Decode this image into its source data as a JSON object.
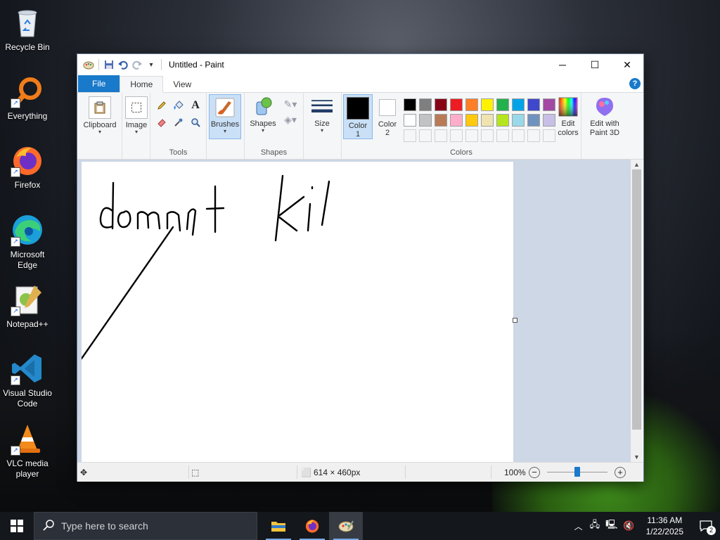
{
  "desktop": {
    "icons": [
      {
        "label": "Recycle Bin"
      },
      {
        "label": "Everything"
      },
      {
        "label": "Firefox"
      },
      {
        "label": "Microsoft Edge"
      },
      {
        "label": "Notepad++"
      },
      {
        "label": "Visual Studio Code"
      },
      {
        "label": "VLC media player"
      }
    ]
  },
  "window": {
    "title": "Untitled - Paint",
    "tabs": {
      "file": "File",
      "home": "Home",
      "view": "View"
    },
    "help": "?"
  },
  "ribbon": {
    "clipboard": "Clipboard",
    "image": "Image",
    "tools_group": "Tools",
    "brushes": "Brushes",
    "shapes": "Shapes",
    "shapes_group": "Shapes",
    "size": "Size",
    "color1": "Color",
    "color1_num": "1",
    "color2": "Color",
    "color2_num": "2",
    "colors_group": "Colors",
    "edit_colors": "Edit colors",
    "edit_paint3d": "Edit with Paint 3D",
    "text_tool": "A",
    "palette_row1": [
      "#000000",
      "#7f7f7f",
      "#880015",
      "#ed1c24",
      "#ff7f27",
      "#fff200",
      "#22b14c",
      "#00a2e8",
      "#3f48cc",
      "#a349a4"
    ],
    "palette_row2": [
      "#ffffff",
      "#c3c3c3",
      "#b97a57",
      "#ffaec9",
      "#ffc90e",
      "#efe4b0",
      "#b5e61d",
      "#99d9ea",
      "#7092be",
      "#c8bfe7"
    ],
    "accent": "#1979ca"
  },
  "canvas": {
    "drawing_text": "domnt Kil"
  },
  "status": {
    "image_size": "614 × 460px",
    "zoom": "100%",
    "zoom_level": 0.5
  },
  "taskbar": {
    "search_placeholder": "Type here to search",
    "time": "11:36 AM",
    "date": "1/22/2025",
    "notification_count": "2"
  }
}
